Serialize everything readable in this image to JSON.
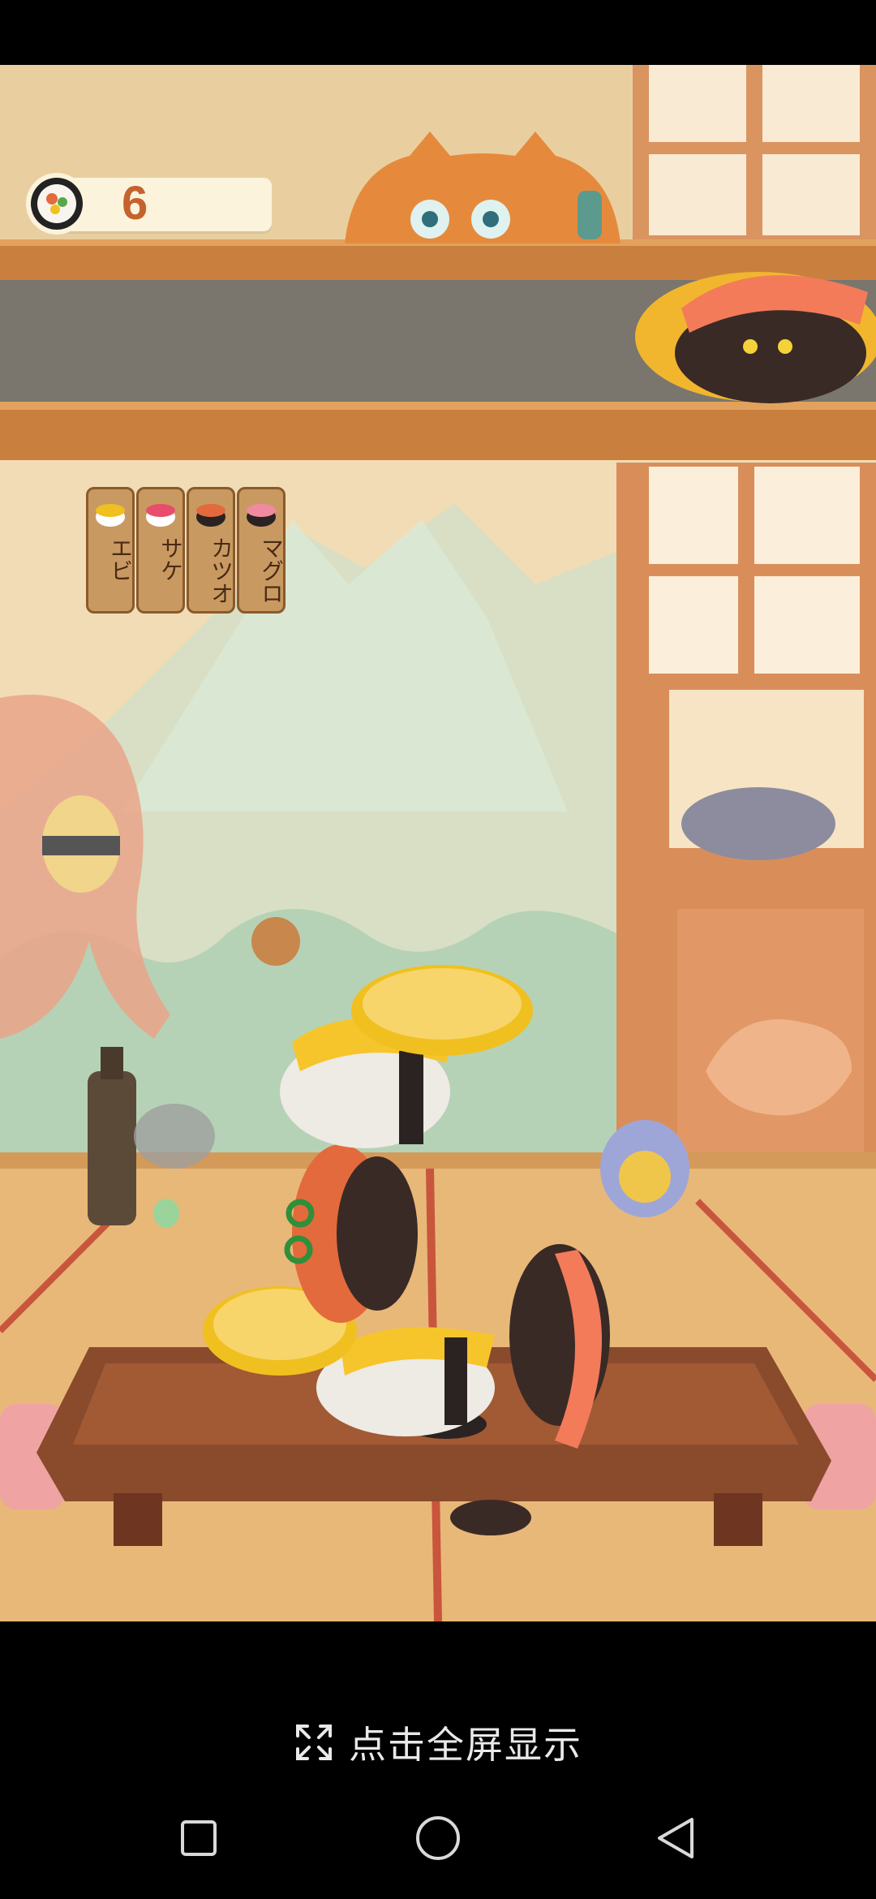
{
  "game": {
    "score": "6",
    "fish_tags": [
      "エビ",
      "サケ",
      "カツオ",
      "マグロ"
    ]
  },
  "fullscreen": {
    "label": "点击全屏显示"
  },
  "nav": {
    "items": [
      "recent-apps",
      "home",
      "back"
    ]
  },
  "colors": {
    "wall": "#f2dcb6",
    "wood": "#c9803e",
    "conveyor": "#7a766d",
    "tatami": "#e8b879",
    "table": "#8a4a2c",
    "score_text": "#c5622d"
  }
}
